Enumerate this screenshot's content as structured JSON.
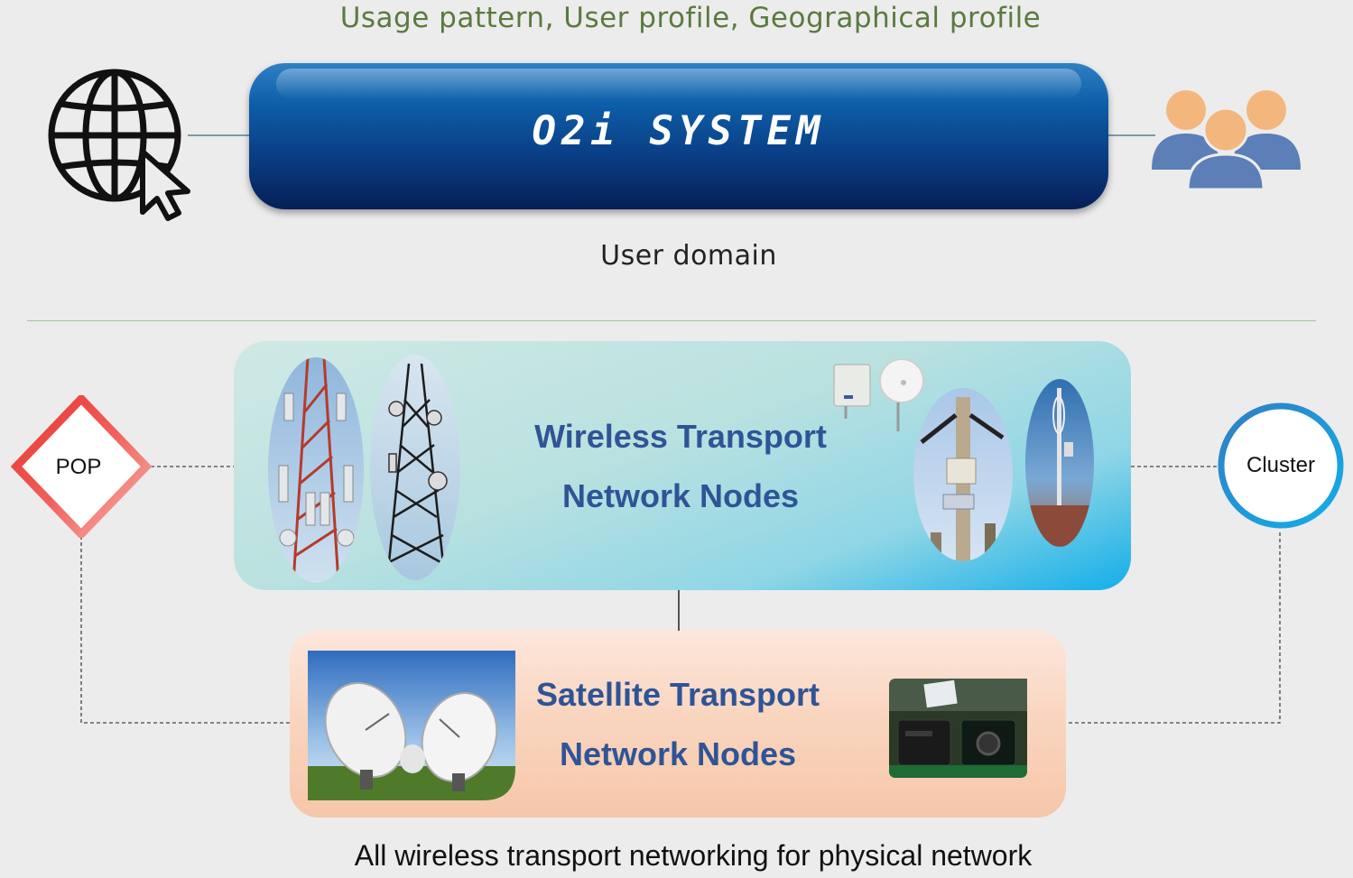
{
  "header": {
    "caption": "Usage pattern, User profile, Geographical profile"
  },
  "system": {
    "title": "O2i SYSTEM",
    "accent_color": "#0a3f86"
  },
  "user_domain": {
    "label": "User domain"
  },
  "wireless_nodes": {
    "title_line1": "Wireless Transport",
    "title_line2": "Network Nodes",
    "color": "#2f5496"
  },
  "satellite_nodes": {
    "title_line1": "Satellite Transport",
    "title_line2": "Network Nodes",
    "color": "#2f5496"
  },
  "pop": {
    "label": "POP",
    "color": "#e8312f"
  },
  "cluster": {
    "label": "Cluster",
    "color": "#1b7cc0"
  },
  "footer": {
    "caption": "All wireless transport networking for physical network"
  },
  "icons": [
    "globe-cursor-icon",
    "users-group-icon"
  ]
}
